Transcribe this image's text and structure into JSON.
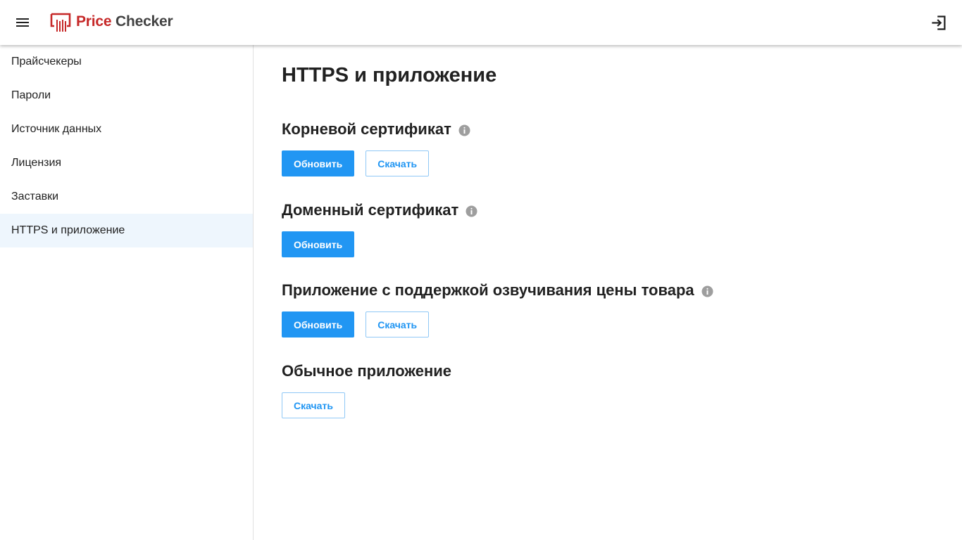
{
  "header": {
    "brand_part1": "Price",
    "brand_part2": " Checker",
    "menu_icon": "menu-icon",
    "logo_icon": "price-checker-logo-icon",
    "logout_icon": "logout-icon",
    "brand_color": "#c62828"
  },
  "sidebar": {
    "items": [
      {
        "label": "Прайсчекеры"
      },
      {
        "label": "Пароли"
      },
      {
        "label": "Источник данных"
      },
      {
        "label": "Лицензия"
      },
      {
        "label": "Заставки"
      },
      {
        "label": "HTTPS и приложение",
        "active": true
      }
    ],
    "active_bg": "#eef6fd"
  },
  "main": {
    "title": "HTTPS и приложение",
    "sections": [
      {
        "title": "Корневой сертификат",
        "has_info": true,
        "buttons": [
          "Обновить",
          "Скачать"
        ]
      },
      {
        "title": "Доменный сертификат",
        "has_info": true,
        "buttons": [
          "Обновить"
        ]
      },
      {
        "title": "Приложение с поддержкой озвучивания цены товара",
        "has_info": true,
        "buttons": [
          "Обновить",
          "Скачать"
        ]
      },
      {
        "title": "Обычное приложение",
        "has_info": false,
        "buttons": [
          "Скачать"
        ]
      }
    ],
    "accent_color": "#2196f3"
  }
}
